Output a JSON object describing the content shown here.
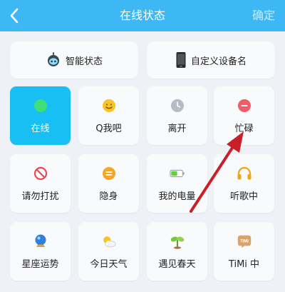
{
  "header": {
    "title": "在线状态",
    "confirm_label": "确定",
    "back_icon": "chevron-left-icon"
  },
  "top_buttons": [
    {
      "label": "智能状态",
      "icon": "robot-icon"
    },
    {
      "label": "自定义设备名",
      "icon": "phone-icon"
    }
  ],
  "statuses": [
    {
      "label": "在线",
      "icon": "green-dot-icon",
      "selected": true
    },
    {
      "label": "Q我吧",
      "icon": "smile-icon"
    },
    {
      "label": "离开",
      "icon": "clock-icon"
    },
    {
      "label": "忙碌",
      "icon": "minus-circle-icon"
    },
    {
      "label": "请勿打扰",
      "icon": "no-entry-icon"
    },
    {
      "label": "隐身",
      "icon": "equals-circle-icon"
    },
    {
      "label": "我的电量",
      "icon": "battery-icon"
    },
    {
      "label": "听歌中",
      "icon": "headphones-icon"
    },
    {
      "label": "星座运势",
      "icon": "crystal-ball-icon"
    },
    {
      "label": "今日天气",
      "icon": "weather-icon"
    },
    {
      "label": "遇见春天",
      "icon": "sprout-icon"
    },
    {
      "label": "TiMi 中",
      "icon": "timi-icon"
    }
  ],
  "timi_badge": "TiMi",
  "colors": {
    "header": "#3db8f5",
    "selected_tile": "#18bff2",
    "annotation_arrow": "#c8202a"
  }
}
